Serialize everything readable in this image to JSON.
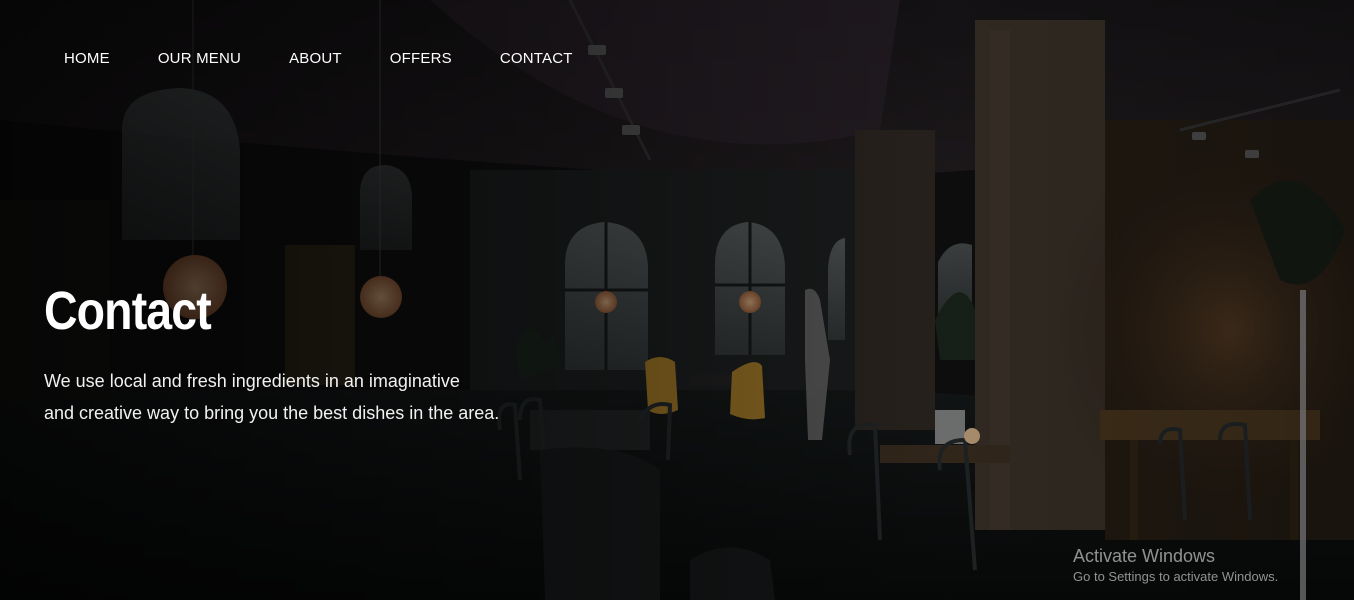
{
  "nav": {
    "items": [
      {
        "label": "HOME"
      },
      {
        "label": "OUR MENU"
      },
      {
        "label": "ABOUT"
      },
      {
        "label": "OFFERS"
      },
      {
        "label": "CONTACT"
      }
    ]
  },
  "hero": {
    "title": "Contact",
    "desc_line1": "We use local and fresh ingredients in an imaginative",
    "desc_line2": "and creative way to bring you the best dishes in the area."
  },
  "watermark": {
    "title": "Activate Windows",
    "subtitle": "Go to Settings to activate Windows."
  },
  "colors": {
    "text": "#ffffff",
    "background": "#0b0b0c",
    "lamp": "#f2a66b",
    "chair": "#d4a23a"
  }
}
